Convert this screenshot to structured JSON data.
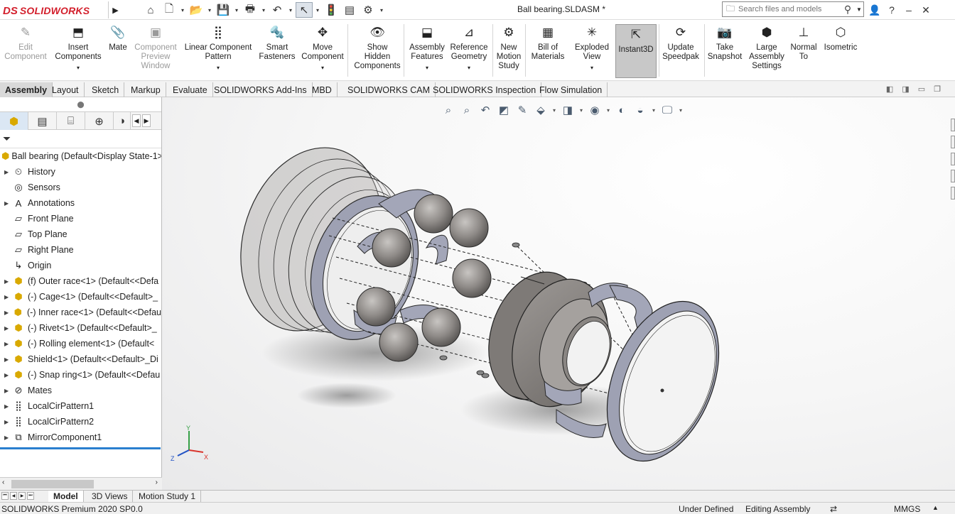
{
  "app": {
    "brand_ds": "DS",
    "brand_name": "SOLIDWORKS"
  },
  "titlebar": {
    "document_title": "Ball bearing.SLDASM *",
    "search_placeholder": "Search files and models"
  },
  "quick_access": [
    {
      "name": "home-icon",
      "glyph": "⌂"
    },
    {
      "name": "new-document-icon",
      "glyph": "🗋"
    },
    {
      "name": "open-icon",
      "glyph": "📂"
    },
    {
      "name": "save-icon",
      "glyph": "💾"
    },
    {
      "name": "print-icon",
      "glyph": "🖶"
    },
    {
      "name": "undo-icon",
      "glyph": "↶"
    },
    {
      "name": "select-icon",
      "glyph": "↖"
    },
    {
      "name": "rebuild-icon",
      "glyph": "🚦"
    },
    {
      "name": "file-properties-icon",
      "glyph": "▤"
    },
    {
      "name": "options-gear-icon",
      "glyph": "⚙"
    }
  ],
  "ribbon": [
    {
      "id": "edit-component",
      "label": "Edit Component",
      "disabled": true,
      "icon": "✎"
    },
    {
      "id": "insert-components",
      "label": "Insert Components",
      "icon": "⬒",
      "caret": true
    },
    {
      "id": "mate",
      "label": "Mate",
      "icon": "📎"
    },
    {
      "id": "component-preview-window",
      "label": "Component Preview Window",
      "disabled": true,
      "icon": "▣"
    },
    {
      "id": "linear-component-pattern",
      "label": "Linear Component Pattern",
      "icon": "⣿",
      "caret": true
    },
    {
      "id": "smart-fasteners",
      "label": "Smart Fasteners",
      "icon": "🔩"
    },
    {
      "id": "move-component",
      "label": "Move Component",
      "icon": "✥",
      "caret": true
    },
    {
      "id": "show-hidden-components",
      "label": "Show Hidden Components",
      "icon": "👁"
    },
    {
      "id": "assembly-features",
      "label": "Assembly Features",
      "icon": "⬓",
      "caret": true
    },
    {
      "id": "reference-geometry",
      "label": "Reference Geometry",
      "icon": "⊿",
      "caret": true
    },
    {
      "id": "new-motion-study",
      "label": "New Motion Study",
      "icon": "⚙"
    },
    {
      "id": "bill-of-materials",
      "label": "Bill of Materials",
      "icon": "▦"
    },
    {
      "id": "exploded-view",
      "label": "Exploded View",
      "icon": "✳",
      "caret": true
    },
    {
      "id": "instant3d",
      "label": "Instant3D",
      "icon": "⇱",
      "active": true
    },
    {
      "id": "update-speedpak",
      "label": "Update Speedpak",
      "icon": "⟳"
    },
    {
      "id": "take-snapshot",
      "label": "Take Snapshot",
      "icon": "📷"
    },
    {
      "id": "large-assembly-settings",
      "label": "Large Assembly Settings",
      "icon": "⬢"
    },
    {
      "id": "normal-to",
      "label": "Normal To",
      "icon": "⊥"
    },
    {
      "id": "isometric",
      "label": "Isometric",
      "icon": "⬡"
    }
  ],
  "tabs": [
    "Assembly",
    "Layout",
    "Sketch",
    "Markup",
    "Evaluate",
    "SOLIDWORKS Add-Ins",
    "MBD",
    "SOLIDWORKS CAM",
    "SOLIDWORKS Inspection",
    "Flow Simulation"
  ],
  "tree": {
    "root": "Ball bearing  (Default<Display State-1>",
    "items": [
      {
        "label": "History",
        "icon": "history-icon",
        "glyph": "⏲",
        "expand": true
      },
      {
        "label": "Sensors",
        "icon": "sensor-icon",
        "glyph": "◎",
        "expand": false
      },
      {
        "label": "Annotations",
        "icon": "annotations-icon",
        "glyph": "A",
        "expand": true
      },
      {
        "label": "Front Plane",
        "icon": "plane-icon",
        "glyph": "▱",
        "expand": false
      },
      {
        "label": "Top Plane",
        "icon": "plane-icon",
        "glyph": "▱",
        "expand": false
      },
      {
        "label": "Right Plane",
        "icon": "plane-icon",
        "glyph": "▱",
        "expand": false
      },
      {
        "label": "Origin",
        "icon": "origin-icon",
        "glyph": "↳",
        "expand": false
      },
      {
        "label": "(f) Outer race<1> (Default<<Defa",
        "icon": "part-icon",
        "glyph": "⬢",
        "expand": true,
        "part": true
      },
      {
        "label": "(-) Cage<1> (Default<<Default>_",
        "icon": "part-icon",
        "glyph": "⬢",
        "expand": true,
        "part": true
      },
      {
        "label": "(-) Inner race<1> (Default<<Defau",
        "icon": "part-icon",
        "glyph": "⬢",
        "expand": true,
        "part": true
      },
      {
        "label": "(-) Rivet<1> (Default<<Default>_",
        "icon": "part-icon",
        "glyph": "⬢",
        "expand": true,
        "part": true
      },
      {
        "label": "(-) Rolling element<1> (Default<",
        "icon": "part-icon",
        "glyph": "⬢",
        "expand": true,
        "part": true
      },
      {
        "label": "Shield<1> (Default<<Default>_Di",
        "icon": "part-icon",
        "glyph": "⬢",
        "expand": true,
        "part": true
      },
      {
        "label": "(-) Snap ring<1> (Default<<Defau",
        "icon": "part-icon",
        "glyph": "⬢",
        "expand": true,
        "part": true
      },
      {
        "label": "Mates",
        "icon": "mates-icon",
        "glyph": "⊘",
        "expand": true
      },
      {
        "label": "LocalCirPattern1",
        "icon": "pattern-icon",
        "glyph": "⣿",
        "expand": true
      },
      {
        "label": "LocalCirPattern2",
        "icon": "pattern-icon",
        "glyph": "⣿",
        "expand": true
      },
      {
        "label": "MirrorComponent1",
        "icon": "mirror-icon",
        "glyph": "⧉",
        "expand": true
      }
    ]
  },
  "triad": {
    "x": "X",
    "y": "Y",
    "z": "Z"
  },
  "model_tabs": [
    "Model",
    "3D Views",
    "Motion Study 1"
  ],
  "status": {
    "product": "SOLIDWORKS Premium 2020 SP0.0",
    "definition": "Under Defined",
    "mode": "Editing Assembly",
    "units": "MMGS"
  },
  "colors": {
    "accent": "#2a7fcf",
    "brand": "#d31f2c",
    "part_metal": "#8c8a88",
    "cage": "#a3a6b8"
  }
}
